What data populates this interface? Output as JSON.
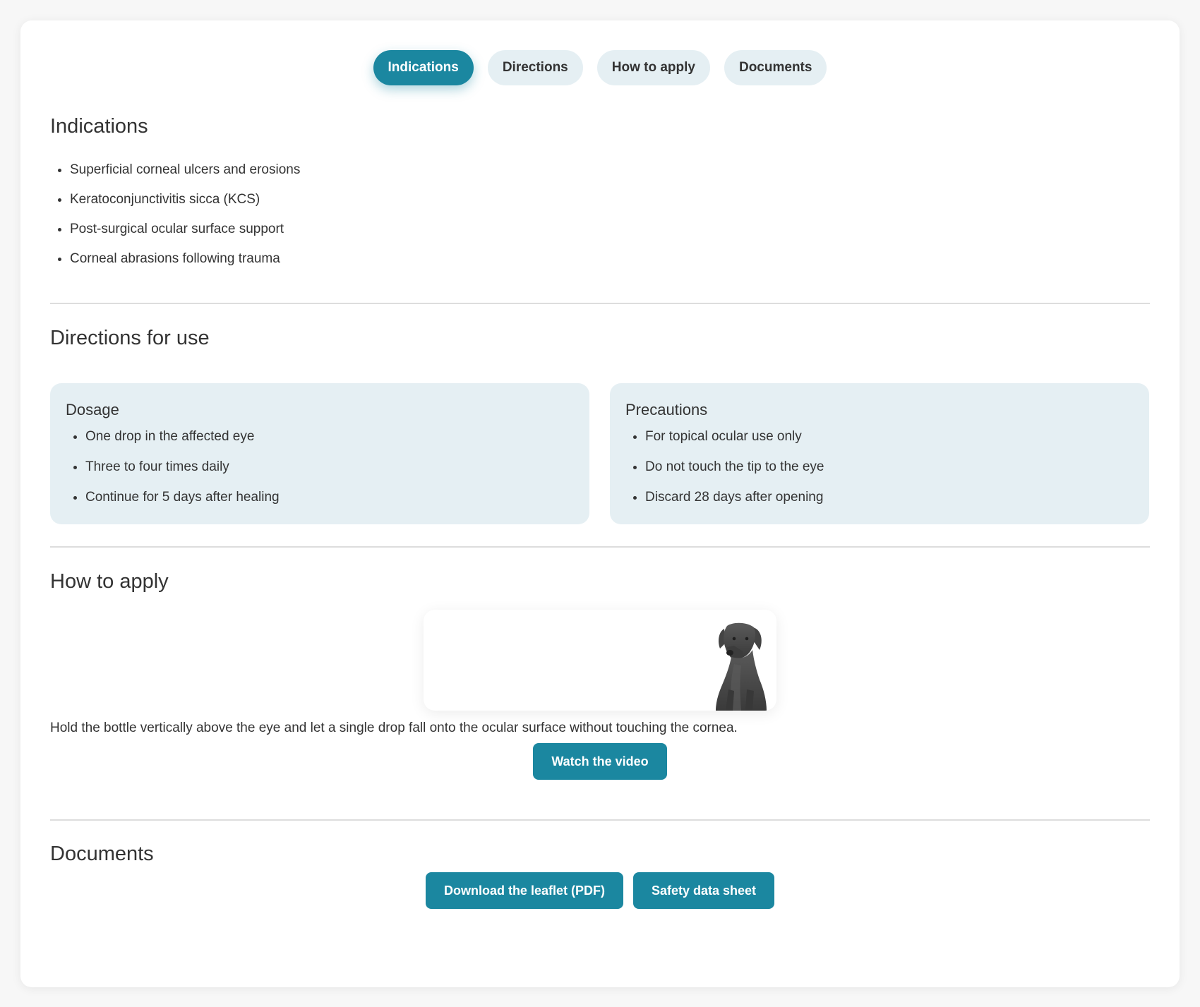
{
  "tabs": [
    {
      "label": "Indications",
      "active": true
    },
    {
      "label": "Directions",
      "active": false
    },
    {
      "label": "How to apply",
      "active": false
    },
    {
      "label": "Documents",
      "active": false
    }
  ],
  "indications": {
    "title": "Indications",
    "items": [
      "Superficial corneal ulcers and erosions",
      "Keratoconjunctivitis sicca (KCS)",
      "Post-surgical ocular surface support",
      "Corneal abrasions following trauma"
    ]
  },
  "directions": {
    "title": "Directions for use",
    "dosage": {
      "title": "Dosage",
      "items": [
        "One drop in the affected eye",
        "Three to four times daily",
        "Continue for 5 days after healing"
      ]
    },
    "precautions": {
      "title": "Precautions",
      "items": [
        "For topical ocular use only",
        "Do not touch the tip to the eye",
        "Discard 28 days after opening"
      ]
    }
  },
  "how_to_apply": {
    "title": "How to apply",
    "text": "Hold the bottle vertically above the eye and let a single drop fall onto the ocular surface without touching the cornea.",
    "video_button": "Watch the video"
  },
  "documents": {
    "title": "Documents",
    "leaflet_button": "Download the leaflet (PDF)",
    "sds_button": "Safety data sheet"
  },
  "colors": {
    "accent": "#1b87a0",
    "panel": "#e5eff3",
    "text": "#333333"
  }
}
